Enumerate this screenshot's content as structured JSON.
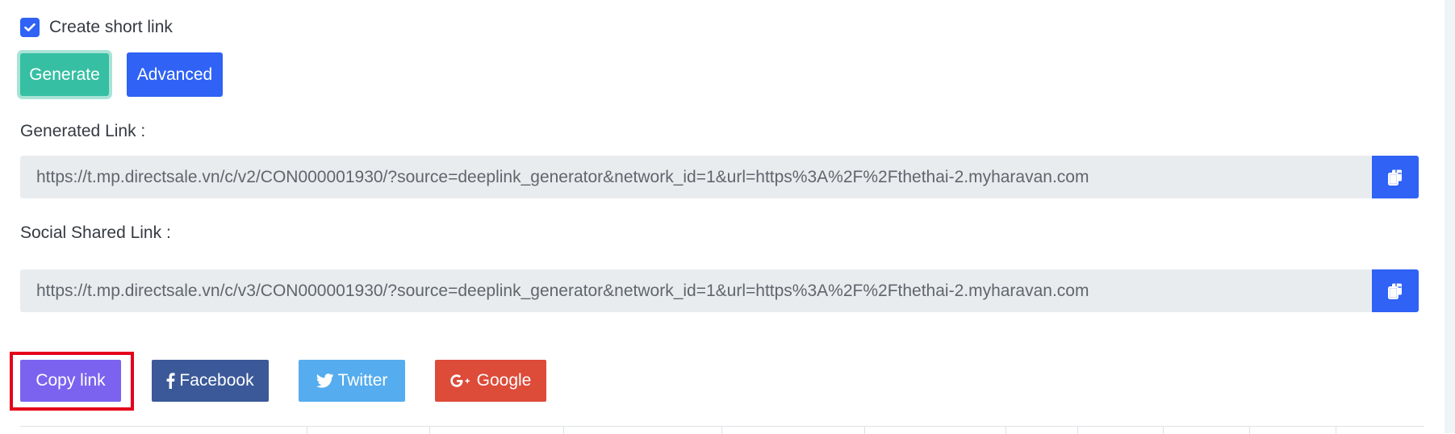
{
  "shortlink": {
    "checkbox_label": "Create short link",
    "checked": true
  },
  "buttons": {
    "generate_label": "Generate",
    "advanced_label": "Advanced"
  },
  "generated_link": {
    "label": "Generated Link :",
    "value": "https://t.mp.directsale.vn/c/v2/CON000001930/?source=deeplink_generator&network_id=1&url=https%3A%2F%2Fthethai-2.myharavan.com"
  },
  "social_link": {
    "label": "Social Shared Link :",
    "value": "https://t.mp.directsale.vn/c/v3/CON000001930/?source=deeplink_generator&network_id=1&url=https%3A%2F%2Fthethai-2.myharavan.com"
  },
  "share": {
    "copy_link_label": "Copy link",
    "facebook_label": "Facebook",
    "twitter_label": "Twitter",
    "google_label": "Google"
  },
  "icons": {
    "checkbox": "check-icon",
    "copy": "copy-icon",
    "facebook": "facebook-icon",
    "twitter": "twitter-icon",
    "google": "google-plus-icon"
  },
  "colors": {
    "primary": "#2f62f5",
    "generate": "#36bfa3",
    "copy_link": "#7b63f0",
    "facebook": "#3b5998",
    "twitter": "#55acee",
    "google": "#dd4b39",
    "highlight": "#e3001b"
  }
}
